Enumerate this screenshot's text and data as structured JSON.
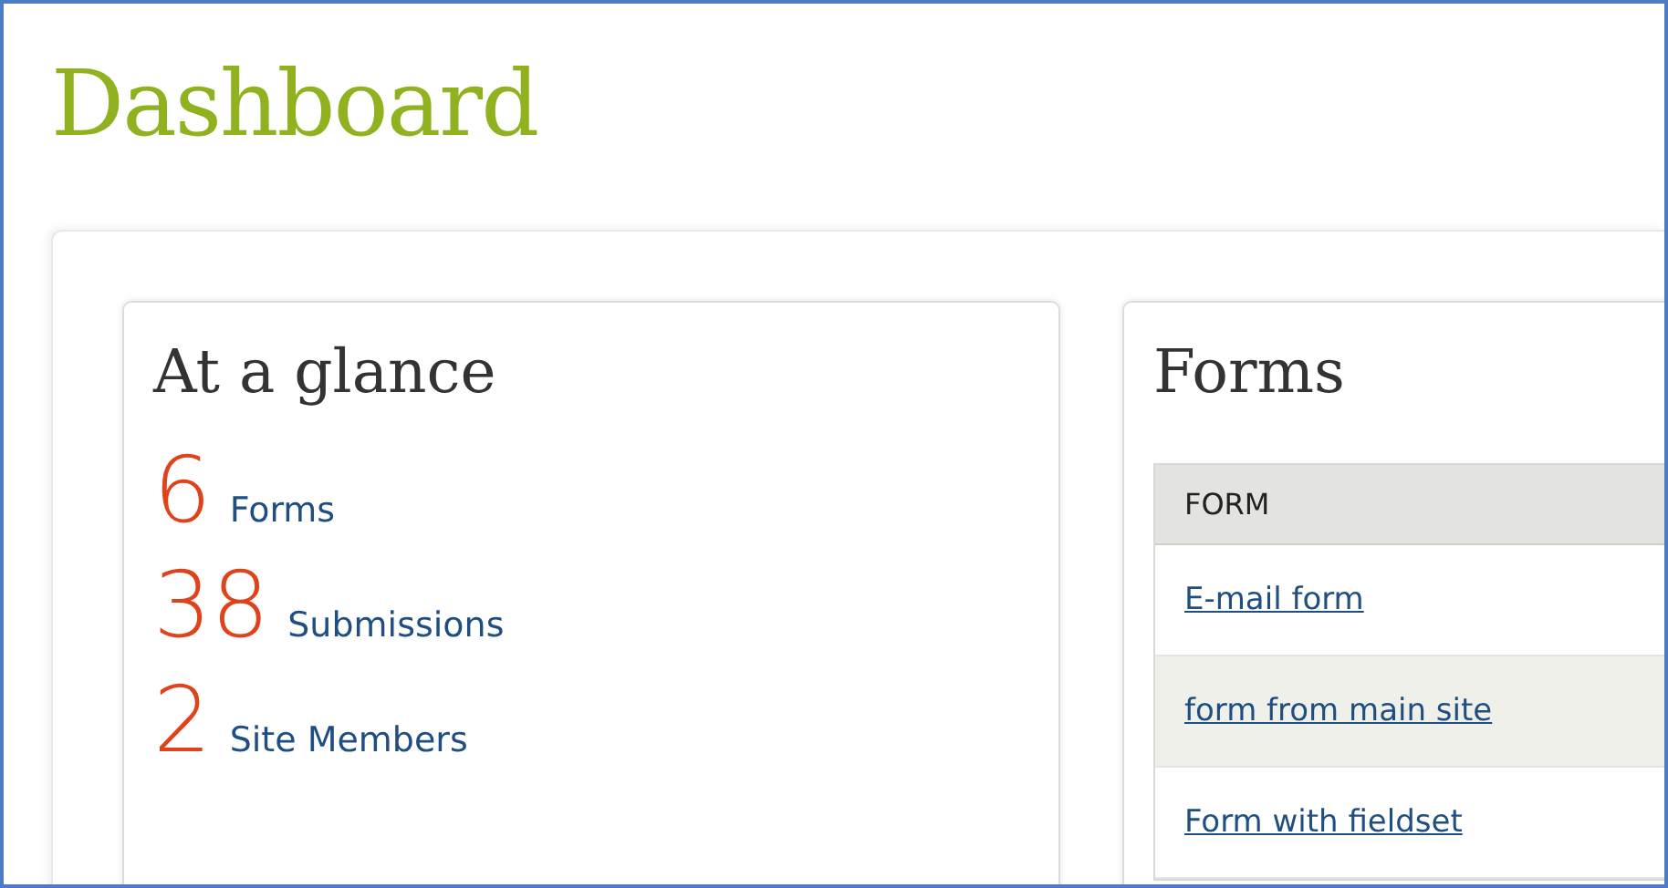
{
  "page": {
    "title": "Dashboard"
  },
  "at_a_glance": {
    "title": "At a glance",
    "stats": [
      {
        "count": "6",
        "label": "Forms"
      },
      {
        "count": "38",
        "label": "Submissions"
      },
      {
        "count": "2",
        "label": "Site Members"
      }
    ]
  },
  "forms": {
    "title": "Forms",
    "table": {
      "columns": [
        "FORM"
      ],
      "rows": [
        [
          "E-mail form"
        ],
        [
          "form from main site"
        ],
        [
          "Form with fieldset"
        ]
      ]
    }
  }
}
